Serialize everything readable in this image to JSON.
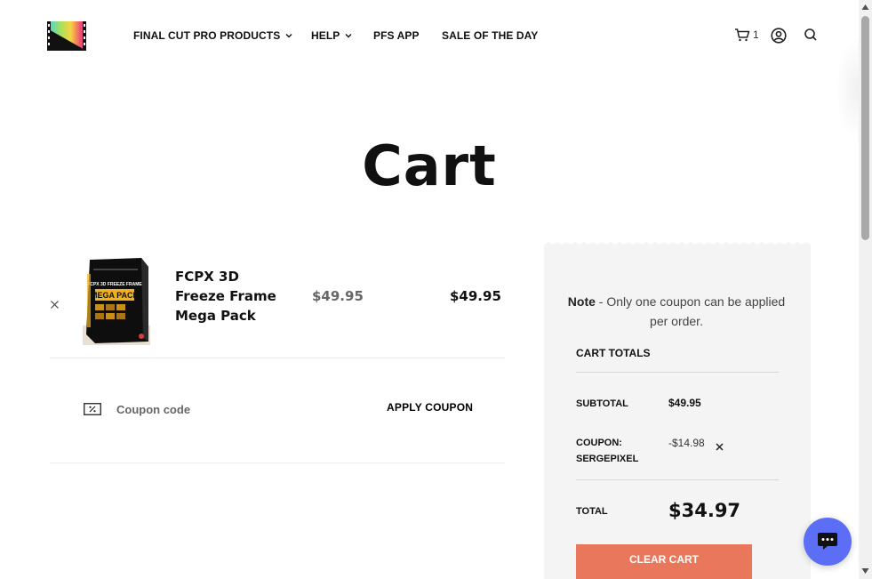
{
  "header": {
    "logo_name": "film-logo",
    "nav": [
      {
        "label": "FINAL CUT PRO PRODUCTS",
        "has_dropdown": true
      },
      {
        "label": "HELP",
        "has_dropdown": true
      },
      {
        "label": "PFS APP",
        "has_dropdown": false
      },
      {
        "label": "SALE OF THE DAY",
        "has_dropdown": false
      }
    ],
    "cart_count": "1",
    "icons": [
      "cart-icon",
      "account-icon",
      "search-icon"
    ]
  },
  "page": {
    "title": "Cart"
  },
  "cart": {
    "items": [
      {
        "name": "FCPX 3D Freeze Frame Mega Pack",
        "price": "$49.95",
        "subtotal": "$49.95",
        "image_text_top": "FCPX 3D FREEZE FRAME",
        "image_text_main": "MEGA PACK"
      }
    ],
    "coupon": {
      "placeholder": "Coupon code",
      "value": "",
      "apply_label": "APPLY COUPON"
    }
  },
  "totals": {
    "note_bold": "Note",
    "note_text": " - Only one coupon can be applied per order.",
    "heading": "CART TOTALS",
    "subtotal_label": "SUBTOTAL",
    "subtotal_value": "$49.95",
    "coupon_label_line1": "COUPON:",
    "coupon_label_line2": "SERGEPIXEL",
    "coupon_value": "-$14.98",
    "total_label": "TOTAL",
    "total_value": "$34.97",
    "clear_cart_label": "CLEAR CART"
  },
  "colors": {
    "accent": "#e8775c",
    "chat": "#5b6ef5",
    "panel_bg": "#f4f4f4"
  }
}
